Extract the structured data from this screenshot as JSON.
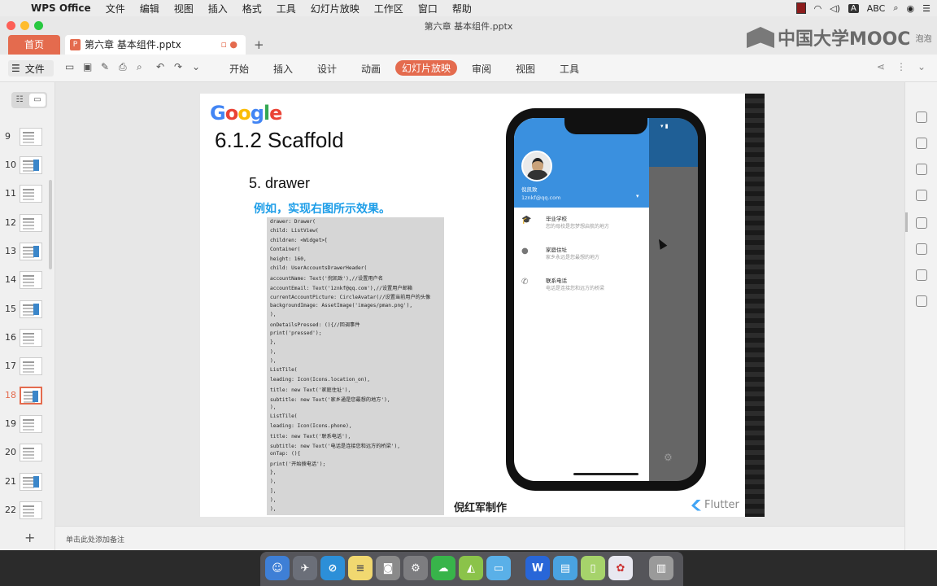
{
  "menubar": {
    "app_name": "WPS Office",
    "items": [
      "文件",
      "编辑",
      "视图",
      "插入",
      "格式",
      "工具",
      "幻灯片放映",
      "工作区",
      "窗口",
      "帮助"
    ],
    "ime_label": "ABC"
  },
  "window": {
    "title": "第六章 基本组件.pptx"
  },
  "tabs": {
    "home_label": "首页",
    "doc_label": "第六章 基本组件.pptx",
    "add_symbol": "+"
  },
  "watermark": {
    "text": "中国大学MOOC",
    "sub": "泡泡"
  },
  "toolbar": {
    "file_label": "文件",
    "ribbon_tabs": [
      "开始",
      "插入",
      "设计",
      "动画",
      "幻灯片放映",
      "审阅",
      "视图",
      "工具"
    ],
    "active_tab": "幻灯片放映"
  },
  "thumbnails": [
    "9",
    "10",
    "11",
    "12",
    "13",
    "14",
    "15",
    "16",
    "17",
    "18",
    "19",
    "20",
    "21",
    "22"
  ],
  "active_slide": "18",
  "notes_placeholder": "单击此处添加备注",
  "slide": {
    "logo_letters": [
      "G",
      "o",
      "o",
      "g",
      "l",
      "e"
    ],
    "title": "6.1.2 Scaffold",
    "item": "5.  drawer",
    "example_text": "例如，实现右图所示效果。",
    "code_lines": [
      "drawer: Drawer(",
      "  child: ListView(",
      "    children: <Widget>[",
      "      Container(",
      "        height: 160,",
      "        child: UserAccountsDrawerHeader(",
      "          accountName: Text('倪凯致'),//设置用户名",
      "          accountEmail: Text('1znkf@qq.com'),//设置用户邮箱",
      "          currentAccountPicture: CircleAvatar(//设置当前用户的头像",
      "            backgroundImage: AssetImage('images/pman.png'),",
      "          ),",
      "          onDetailsPressed: (){//回调事件",
      "            print('pressed');",
      "          },",
      "        ),",
      "      ),",
      "      ListTile(",
      "        leading: Icon(Icons.location_on),",
      "        title: new Text('家庭住址'),",
      "        subtitle: new Text('家乡通是您最想的地方'),",
      "      ),",
      "      ListTile(",
      "        leading: Icon(Icons.phone),",
      "        title: new Text('联系电话'),",
      "        subtitle: new Text('电话是连接您和远方的桥梁'),",
      "        onTap: (){",
      "          print('开始拨电话');",
      "        },",
      "      ),",
      "    ],",
      "  ),",
      "),"
    ],
    "author": "倪红军制作",
    "flutter_label": "Flutter"
  },
  "phone": {
    "account_name": "倪凯致",
    "account_email": "1znkf@qq.com",
    "tiles": [
      {
        "icon": "school-icon",
        "glyph": "🎓",
        "title": "毕业学校",
        "subtitle": "您的母校是您梦想启航的地方"
      },
      {
        "icon": "location-icon",
        "glyph": "●",
        "title": "家庭住址",
        "subtitle": "家乡永远是您最想的地方"
      },
      {
        "icon": "phone-icon",
        "glyph": "✆",
        "title": "联系电话",
        "subtitle": "电话是连接您和远方的桥梁"
      }
    ]
  },
  "colors": {
    "accent": "#e46b4e",
    "drawer_header": "#3a90df",
    "example_text": "#1e9ee8"
  }
}
